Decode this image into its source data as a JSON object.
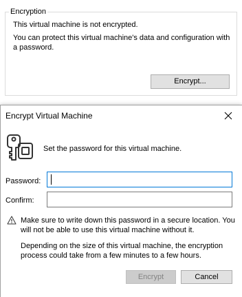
{
  "encryption_group": {
    "legend": "Encryption",
    "status_text": "This virtual machine is not encrypted.",
    "description": "You can protect this virtual machine's data and configuration with a password.",
    "encrypt_button_label": "Encrypt..."
  },
  "dialog": {
    "title": "Encrypt Virtual Machine",
    "close_icon": "close-icon",
    "header_icon": "lock-key-icon",
    "header_text": "Set the password for this virtual machine.",
    "password": {
      "label": "Password:",
      "value": ""
    },
    "confirm": {
      "label": "Confirm:",
      "value": ""
    },
    "warning_icon": "warning-triangle-icon",
    "warning_text": "Make sure to write down this password in a secure location. You will not be able to use this virtual machine without it.",
    "duration_text": "Depending on the size of this virtual machine, the encryption process could take from a few minutes to a few hours.",
    "encrypt_button_label": "Encrypt",
    "encrypt_button_disabled": true,
    "cancel_button_label": "Cancel"
  },
  "colors": {
    "focus_border": "#0078d7",
    "button_face": "#e1e1e1",
    "disabled_button_face": "#cccccc",
    "disabled_text": "#838383",
    "icon_stroke": "#333333"
  }
}
